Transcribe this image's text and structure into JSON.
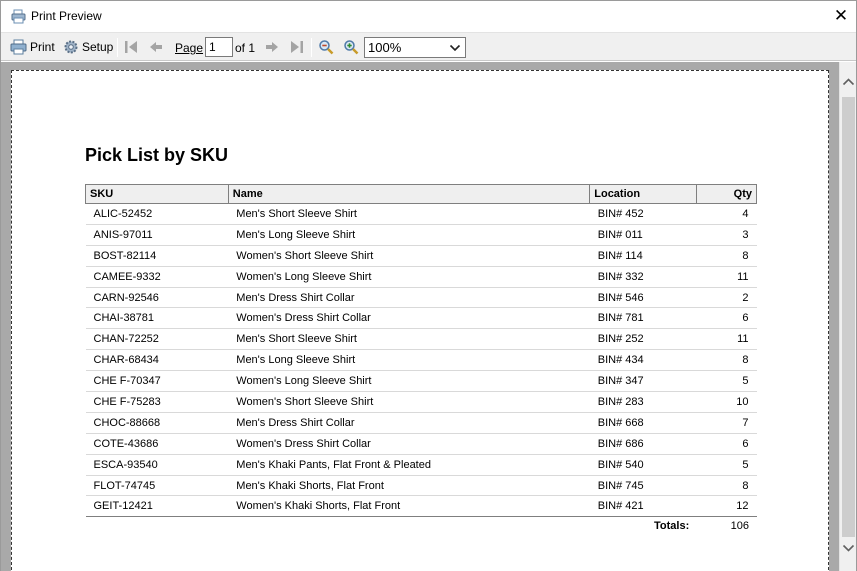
{
  "window": {
    "title": "Print Preview",
    "close_glyph": "✕"
  },
  "toolbar": {
    "print_label": "Print",
    "setup_label": "Setup",
    "page_label": "Page",
    "page_value": "1",
    "of_label": "of 1",
    "zoom_value": "100%",
    "icons": [
      "printer-icon",
      "gear-icon",
      "first-page-icon",
      "prev-page-icon",
      "next-page-icon",
      "last-page-icon",
      "zoom-out-icon",
      "zoom-in-icon"
    ]
  },
  "report": {
    "title": "Pick List by SKU",
    "columns": [
      "SKU",
      "Name",
      "Location",
      "Qty"
    ],
    "rows": [
      [
        "ALIC-52452",
        "Men's Short Sleeve Shirt",
        "BIN# 452",
        "4"
      ],
      [
        "ANIS-97011",
        "Men's Long Sleeve Shirt",
        "BIN# 011",
        "3"
      ],
      [
        "BOST-82114",
        "Women's Short Sleeve Shirt",
        "BIN# 114",
        "8"
      ],
      [
        "CAMEE-9332",
        "Women's Long Sleeve Shirt",
        "BIN# 332",
        "11"
      ],
      [
        "CARN-92546",
        "Men's Dress Shirt Collar",
        "BIN# 546",
        "2"
      ],
      [
        "CHAI-38781",
        "Women's Dress Shirt Collar",
        "BIN# 781",
        "6"
      ],
      [
        "CHAN-72252",
        "Men's Short Sleeve Shirt",
        "BIN# 252",
        "11"
      ],
      [
        "CHAR-68434",
        "Men's Long Sleeve Shirt",
        "BIN# 434",
        "8"
      ],
      [
        "CHE F-70347",
        "Women's Long Sleeve Shirt",
        "BIN# 347",
        "5"
      ],
      [
        "CHE F-75283",
        "Women's Short Sleeve Shirt",
        "BIN# 283",
        "10"
      ],
      [
        "CHOC-88668",
        "Men's Dress Shirt Collar",
        "BIN# 668",
        "7"
      ],
      [
        "COTE-43686",
        "Women's Dress Shirt Collar",
        "BIN# 686",
        "6"
      ],
      [
        "ESCA-93540",
        "Men's Khaki Pants, Flat Front & Pleated",
        "BIN# 540",
        "5"
      ],
      [
        "FLOT-74745",
        "Men's Khaki Shorts, Flat Front",
        "BIN# 745",
        "8"
      ],
      [
        "GEIT-12421",
        "Women's Khaki Shorts, Flat Front",
        "BIN# 421",
        "12"
      ]
    ],
    "totals_label": "Totals:",
    "totals_value": "106"
  }
}
